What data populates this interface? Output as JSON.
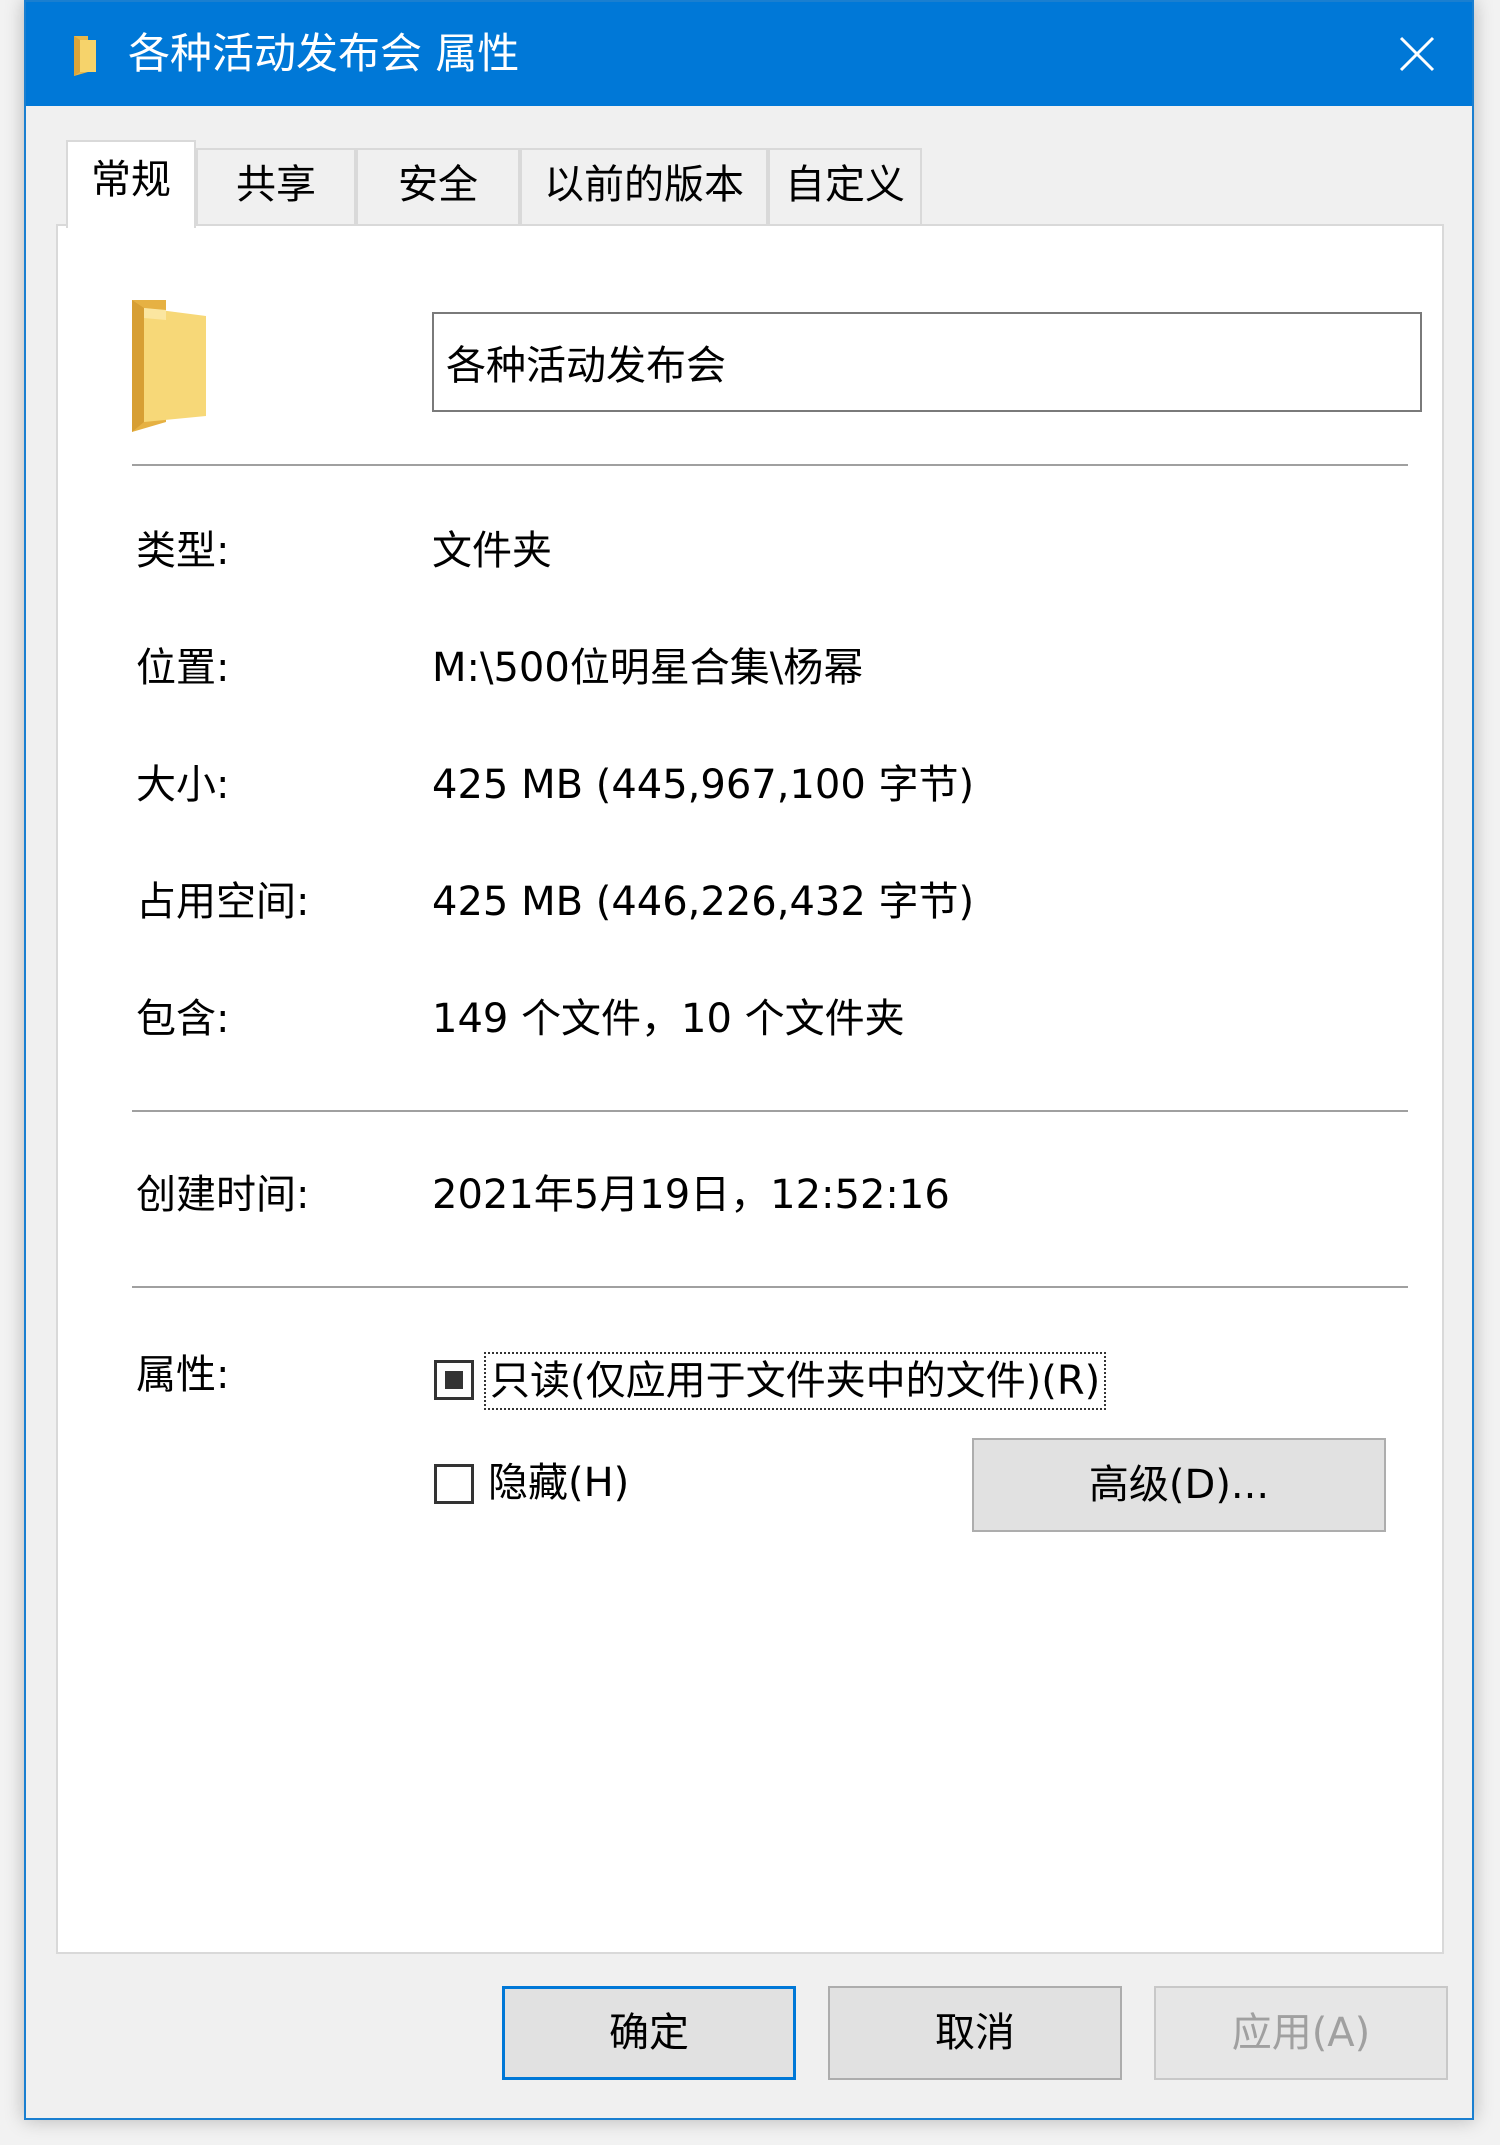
{
  "window": {
    "title": "各种活动发布会 属性",
    "accent_color": "#0078d7",
    "folder_color": "#f3c75a"
  },
  "tabs": [
    {
      "label": "常规",
      "active": true
    },
    {
      "label": "共享",
      "active": false
    },
    {
      "label": "安全",
      "active": false
    },
    {
      "label": "以前的版本",
      "active": false
    },
    {
      "label": "自定义",
      "active": false
    }
  ],
  "general": {
    "name_value": "各种活动发布会",
    "type_label": "类型:",
    "type_value": "文件夹",
    "location_label": "位置:",
    "location_value": "M:\\500位明星合集\\杨幂",
    "size_label": "大小:",
    "size_value": "425 MB (445,967,100 字节)",
    "disk_size_label": "占用空间:",
    "disk_size_value": "425 MB (446,226,432 字节)",
    "contains_label": "包含:",
    "contains_value": "149 个文件，10 个文件夹",
    "created_label": "创建时间:",
    "created_value": "2021年5月19日，12:52:16",
    "attributes_label": "属性:",
    "readonly_label": "只读(仅应用于文件夹中的文件)(R)",
    "readonly_state": "indeterminate",
    "hidden_label": "隐藏(H)",
    "hidden_state": "unchecked",
    "advanced_label": "高级(D)..."
  },
  "footer": {
    "ok_label": "确定",
    "cancel_label": "取消",
    "apply_label": "应用(A)"
  }
}
